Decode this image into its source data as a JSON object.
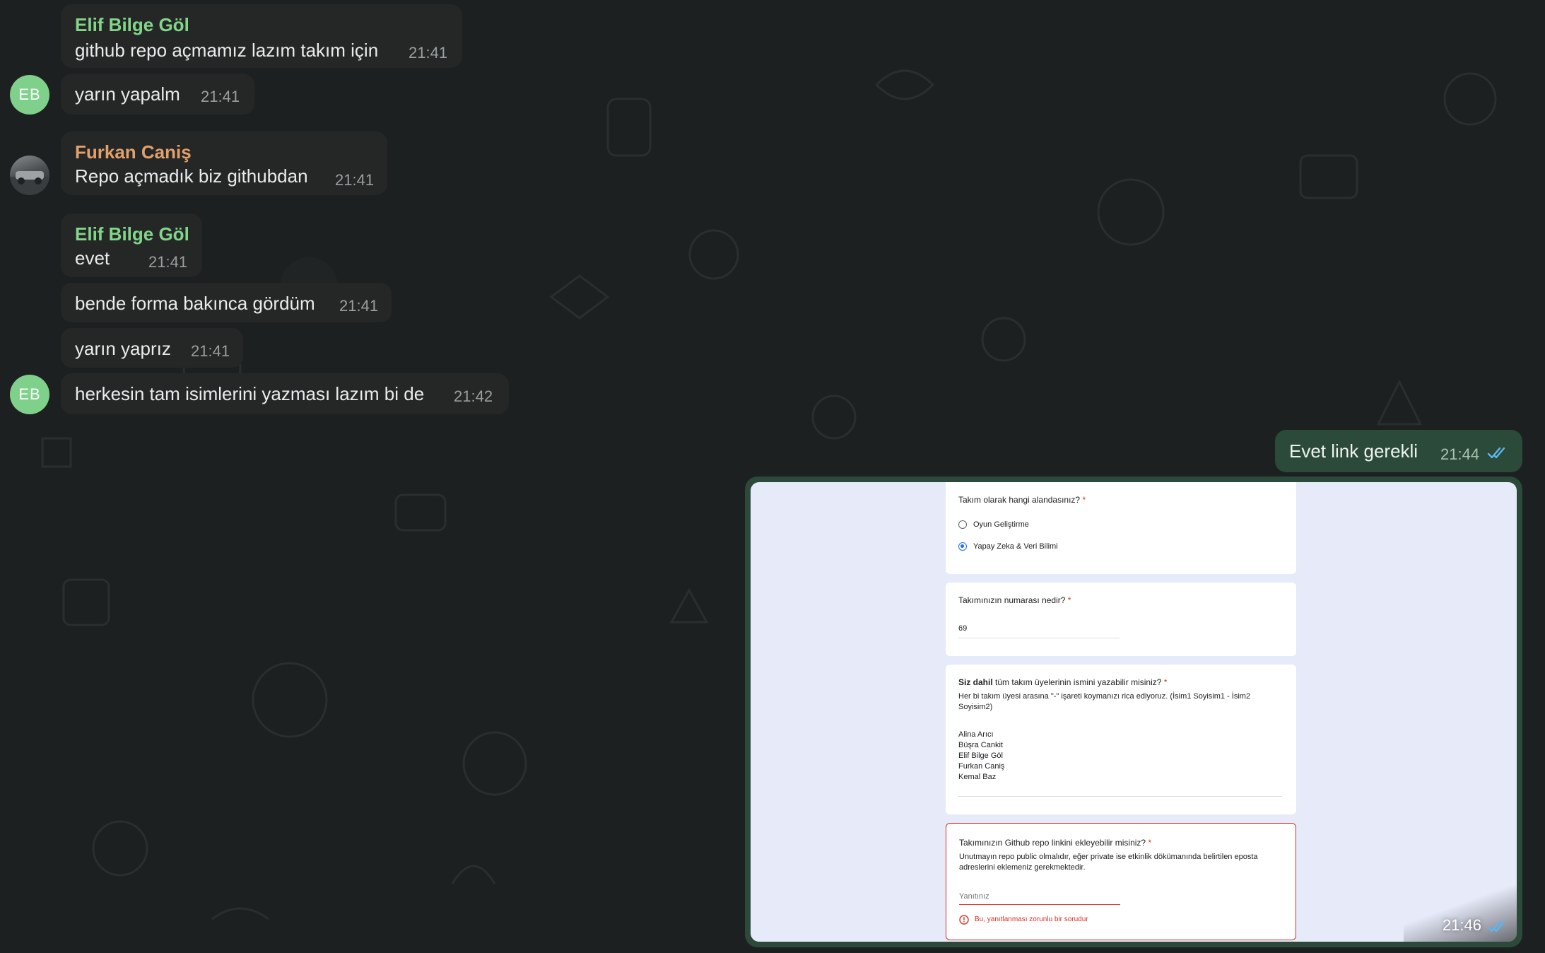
{
  "messages": [
    {
      "sender": "Elif Bilge Göl",
      "text": "github repo açmamız lazım takım için",
      "time": "21:41"
    },
    {
      "avatar": "EB",
      "text": "yarın yapalm",
      "time": "21:41"
    },
    {
      "sender": "Furkan Caniş",
      "text": "Repo açmadık biz githubdan",
      "time": "21:41"
    },
    {
      "sender": "Elif Bilge Göl",
      "text": "evet",
      "time": "21:41"
    },
    {
      "text": "bende forma bakınca gördüm",
      "time": "21:41"
    },
    {
      "text": "yarın yaprız",
      "time": "21:41"
    },
    {
      "avatar": "EB",
      "text": "herkesin tam isimlerini yazması lazım bi de",
      "time": "21:42"
    }
  ],
  "outgoing": [
    {
      "text": "Evet link gerekli",
      "time": "21:44",
      "status": "double-check-read"
    },
    {
      "type": "image",
      "time": "21:46",
      "status": "double-check-read"
    }
  ],
  "form": {
    "q1": {
      "title": "Takım olarak hangi alandasınız?",
      "required": "*",
      "options": [
        "Oyun Geliştirme",
        "Yapay Zeka & Veri Bilimi"
      ],
      "selected": "Yapay Zeka & Veri Bilimi"
    },
    "q2": {
      "title": "Takımınızın numarası nedir?",
      "required": "*",
      "answer": "69"
    },
    "q3": {
      "title_bold": "Siz dahil",
      "title_rest": " tüm takım üyelerinin ismini yazabilir  misiniz?",
      "required": "*",
      "desc": "Her bi takım üyesi arasına \"-\" işareti koymanızı rica ediyoruz. (İsim1 Soyisim1 - İsim2 Soyisim2)",
      "names": [
        "Alina Arıcı",
        "Büşra Cankit",
        "Elif Bilge Göl",
        "Furkan Caniş",
        "Kemal Baz"
      ]
    },
    "q4": {
      "title": "Takımınızın Github repo linkini ekleyebilir misiniz?",
      "required": "*",
      "desc": "Unutmayın repo public olmalıdır, eğer private ise etkinlik dökümanında belirtilen eposta adreslerini eklemeniz gerekmektedir.",
      "placeholder": "Yanıtınız",
      "error": "Bu, yanıtlanması zorunlu bir sorudur"
    }
  },
  "colors": {
    "incoming": "#252727",
    "outgoing": "#2c4a39",
    "sender_green": "#82d68a",
    "sender_orange": "#e2a06b",
    "check_blue": "#5bb6f0",
    "error_red": "#d93025"
  }
}
